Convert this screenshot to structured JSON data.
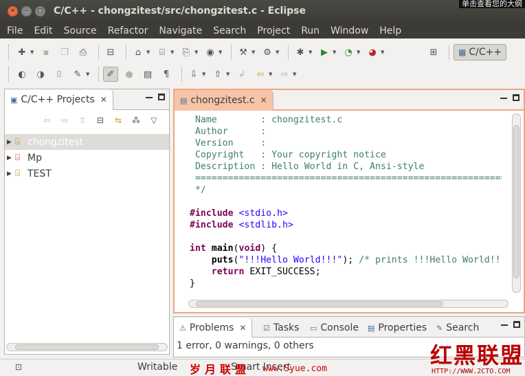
{
  "window": {
    "title": "C/C++ - chongzitest/src/chongzitest.c - Eclipse",
    "close_glyph": "×",
    "min_glyph": "–",
    "max_glyph": "□",
    "corner_tip": "单击查看您的大纲"
  },
  "menu": [
    "File",
    "Edit",
    "Source",
    "Refactor",
    "Navigate",
    "Search",
    "Project",
    "Run",
    "Window",
    "Help"
  ],
  "toolbar": {
    "perspective_label": "C/C++"
  },
  "project_explorer": {
    "tab_label": "C/C++ Projects",
    "close_glyph": "✕",
    "items": [
      {
        "label": "chongzitest",
        "selected": true
      },
      {
        "label": "Mp",
        "selected": false
      },
      {
        "label": "TEST",
        "selected": false
      }
    ]
  },
  "editor": {
    "tab_label": "chongzitest.c",
    "close_glyph": "✕",
    "lines": [
      " Name        : chongzitest.c",
      " Author      :",
      " Version     :",
      " Copyright   : Your copyright notice",
      " Description : Hello World in C, Ansi-style",
      " ============================================================================",
      " */",
      "",
      "#include <stdio.h>",
      "#include <stdlib.h>",
      "",
      "int main(void) {",
      "    puts(\"!!!Hello World!!!\"); /* prints !!!Hello World!!! */",
      "    return EXIT_SUCCESS;",
      "}"
    ]
  },
  "bottom_panel": {
    "tabs": [
      {
        "label": "Problems",
        "active": true
      },
      {
        "label": "Tasks",
        "active": false
      },
      {
        "label": "Console",
        "active": false
      },
      {
        "label": "Properties",
        "active": false
      },
      {
        "label": "Search",
        "active": false
      }
    ],
    "close_glyph": "✕",
    "summary": "1 error, 0 warnings, 0 others"
  },
  "statusbar": {
    "mode": "Writable",
    "insert": "Smart Insert"
  },
  "watermarks": {
    "left_text": "岁月联盟",
    "url_text": "www.Syue.com",
    "right_big": "红黑联盟",
    "right_small": "HTTP://WWW.2CTO.COM"
  }
}
